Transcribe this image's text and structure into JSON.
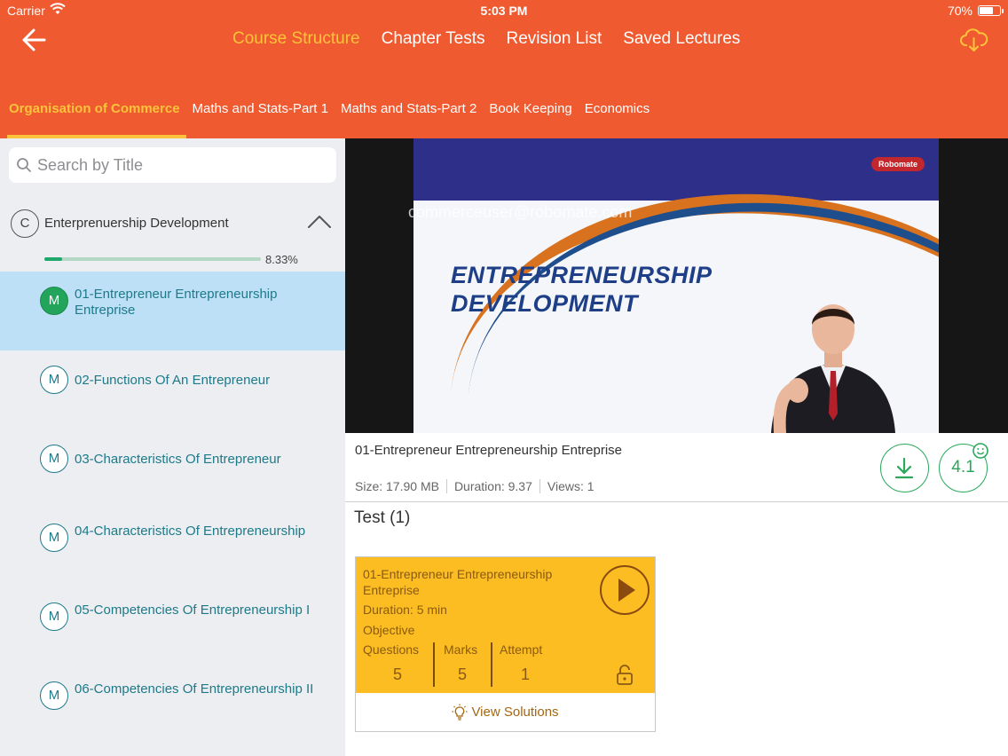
{
  "status_bar": {
    "carrier": "Carrier",
    "time": "5:03 PM",
    "battery": "70%",
    "battery_level": 0.7
  },
  "top_nav": {
    "items": [
      {
        "label": "Course Structure",
        "active": true
      },
      {
        "label": "Chapter Tests"
      },
      {
        "label": "Revision List"
      },
      {
        "label": "Saved Lectures"
      }
    ]
  },
  "subject_tabs": [
    {
      "label": "Organisation of Commerce",
      "active": true
    },
    {
      "label": "Maths and Stats-Part 1"
    },
    {
      "label": "Maths and Stats-Part 2"
    },
    {
      "label": "Book Keeping"
    },
    {
      "label": "Economics"
    }
  ],
  "search": {
    "placeholder": "Search by Title"
  },
  "chapter": {
    "badge": "C",
    "title": "Enterprenuership Development",
    "progress_text": "8.33%",
    "progress": 0.0833
  },
  "lectures": [
    {
      "badge": "M",
      "title": "01-Entrepreneur Entrepreneurship Entreprise",
      "active": true
    },
    {
      "badge": "M",
      "title": "02-Functions Of An Entrepreneur"
    },
    {
      "badge": "M",
      "title": "03-Characteristics Of Entrepreneur"
    },
    {
      "badge": "M",
      "title": "04-Characteristics Of Entrepreneurship"
    },
    {
      "badge": "M",
      "title": "05-Competencies Of Entrepreneurship I"
    },
    {
      "badge": "M",
      "title": "06-Competencies Of Entrepreneurship II"
    }
  ],
  "video": {
    "slide_title_line1": "ENTREPRENEURSHIP",
    "slide_title_line2": "DEVELOPMENT",
    "logo": "Robomate",
    "watermark": "commerceuser@robomate.com"
  },
  "lecture_info": {
    "title": "01-Entrepreneur Entrepreneurship Entreprise",
    "size": "Size: 17.90 MB",
    "duration": "Duration: 9.37",
    "views": "Views: 1",
    "rating": "4.1"
  },
  "test_section": {
    "heading": "Test (1)",
    "card": {
      "title": "01-Entrepreneur Entrepreneurship Entreprise",
      "duration": "Duration:  5 min",
      "type": "Objective",
      "questions_label": "Questions",
      "questions_value": "5",
      "marks_label": "Marks",
      "marks_value": "5",
      "attempt_label": "Attempt",
      "attempt_value": "1",
      "view_solutions": "View Solutions"
    }
  },
  "colors": {
    "header": "#f05a30",
    "accent_yellow": "#fdc33a",
    "green": "#2aa85b",
    "teal_text": "#1d7a8a",
    "card_yellow": "#fbbd22"
  }
}
